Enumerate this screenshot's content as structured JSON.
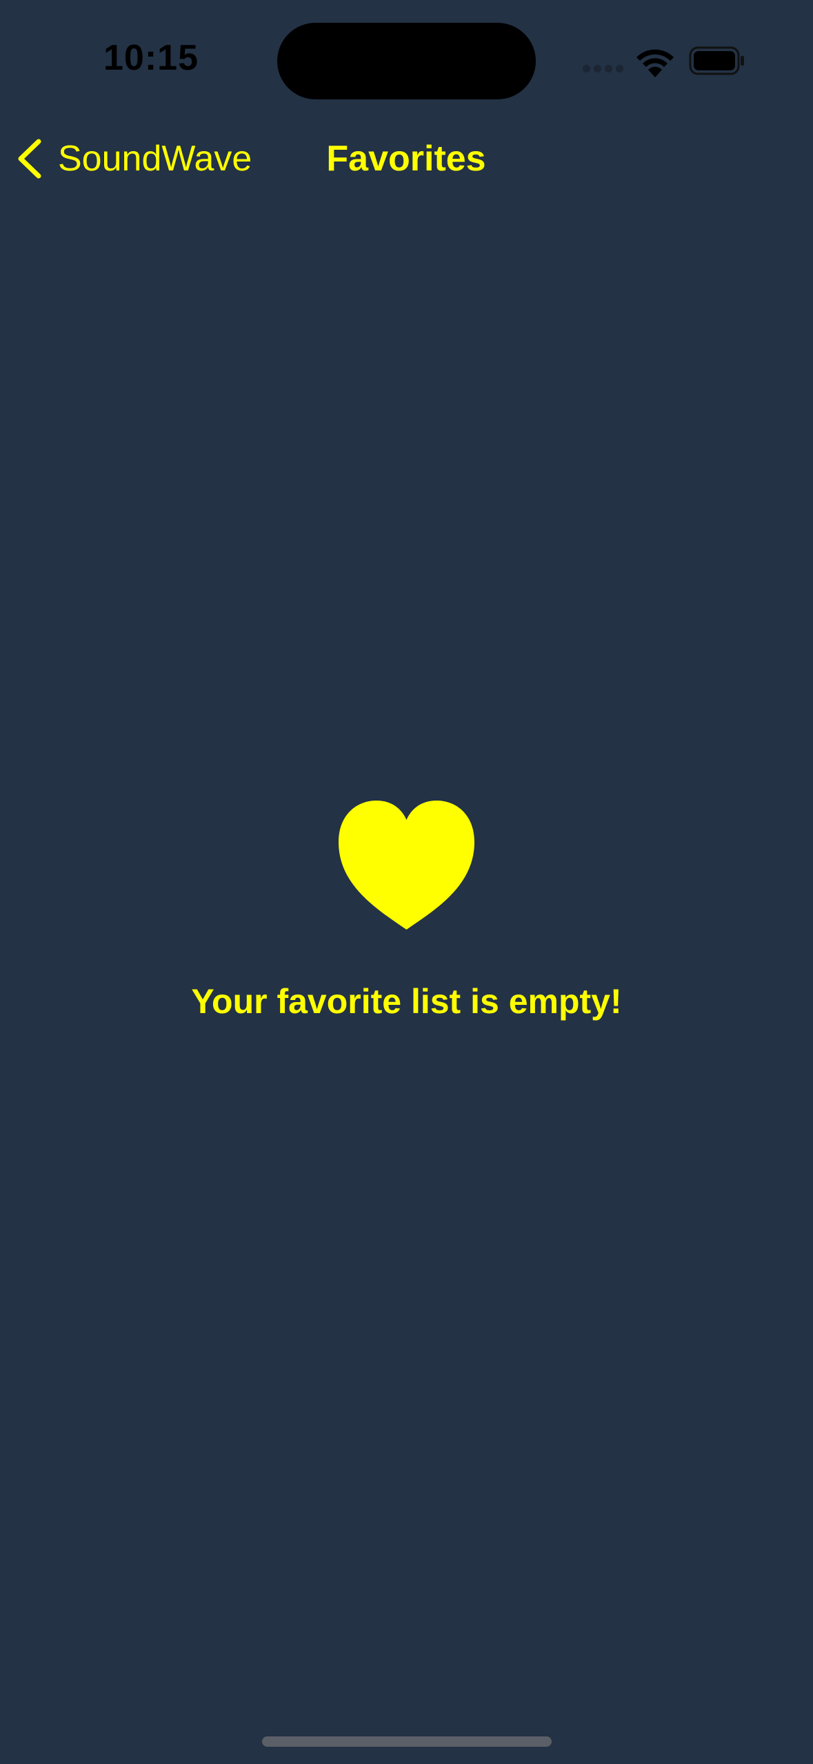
{
  "colors": {
    "background": "#233245",
    "accent": "#ffff00",
    "status_bar_foreground": "#000000"
  },
  "status_bar": {
    "time": "10:15",
    "icons": [
      "signal-icon",
      "wifi-icon",
      "battery-icon"
    ]
  },
  "nav_bar": {
    "back_label": "SoundWave",
    "back_icon": "chevron-left-icon",
    "title": "Favorites"
  },
  "empty_state": {
    "icon": "heart-icon",
    "message": "Your favorite list is empty!"
  }
}
